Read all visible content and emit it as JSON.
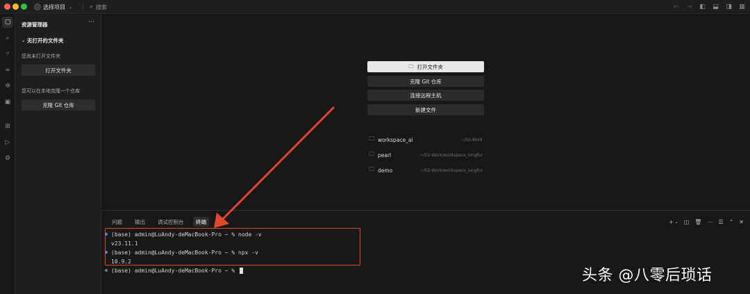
{
  "titlebar": {
    "project_label": "选择项目",
    "search_placeholder": "搜索"
  },
  "sidebar": {
    "title": "资源管理器",
    "section_title": "无打开的文件夹",
    "no_folder_text": "您尚未打开文件夹",
    "open_folder_button": "打开文件夹",
    "clone_text": "您可以在本地克隆一个仓库",
    "clone_button": "克隆 Git 仓库"
  },
  "welcome": {
    "actions": [
      {
        "label": "打开文件夹",
        "icon": "folder-open-icon"
      },
      {
        "label": "克隆 Git 仓库"
      },
      {
        "label": "连接远程主机"
      },
      {
        "label": "新建文件"
      }
    ],
    "recent": [
      {
        "name": "workspace_ai",
        "path": "~/02-Work"
      },
      {
        "name": "pearl",
        "path": "~/02-Work/workspace_longfor"
      },
      {
        "name": "demo",
        "path": "~/02-Work/workspace_longfor"
      }
    ]
  },
  "panel": {
    "tabs": [
      "问题",
      "输出",
      "调试控制台",
      "终端"
    ],
    "active_tab": "终端"
  },
  "terminal": {
    "lines": [
      "(base) admin@LuAndy-deMacBook-Pro ~ % node -v",
      "v23.11.1",
      "(base) admin@LuAndy-deMacBook-Pro ~ % npx -v",
      "10.9.2",
      "(base) admin@LuAndy-deMacBook-Pro ~ % "
    ]
  },
  "watermark": "头条 @八零后琐话",
  "colors": {
    "annotation": "#e4462d",
    "prompt_dot": "#3b8eea",
    "background": "#181818"
  }
}
